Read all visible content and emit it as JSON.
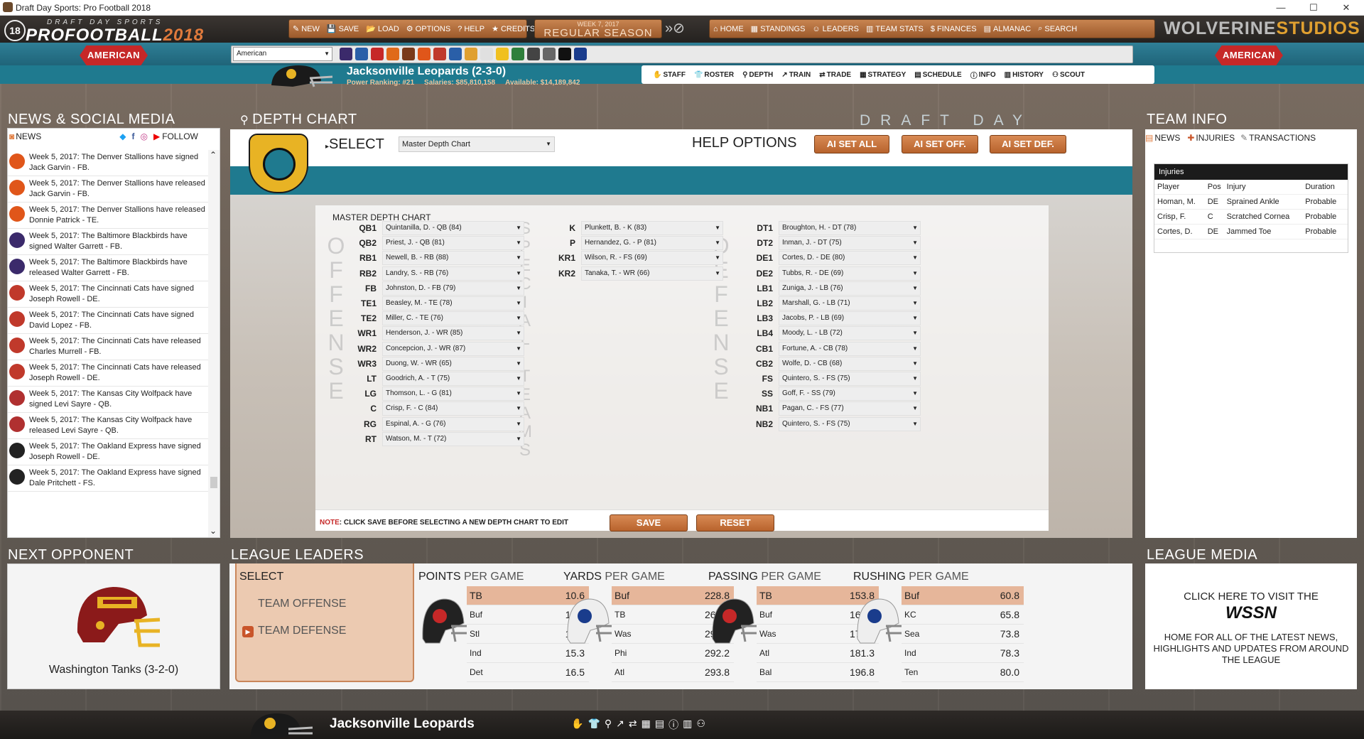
{
  "window": {
    "title": "Draft Day Sports: Pro Football 2018",
    "min": "—",
    "max": "☐",
    "close": "✕"
  },
  "logo": {
    "number": "18",
    "small": "DRAFT DAY SPORTS",
    "main": "PROFOOTBALL",
    "year": "2018"
  },
  "top_menu": [
    {
      "icon": "✎",
      "label": "NEW",
      "name": "new"
    },
    {
      "icon": "💾",
      "label": "SAVE",
      "name": "save"
    },
    {
      "icon": "📂",
      "label": "LOAD",
      "name": "load"
    },
    {
      "icon": "⚙",
      "label": "OPTIONS",
      "name": "options"
    },
    {
      "icon": "?",
      "label": "HELP",
      "name": "help"
    },
    {
      "icon": "★",
      "label": "CREDITS",
      "name": "credits"
    }
  ],
  "season": {
    "week": "WEEK 7, 2017",
    "phase": "REGULAR SEASON"
  },
  "main_nav": [
    {
      "icon": "⌂",
      "label": "HOME",
      "name": "home"
    },
    {
      "icon": "▦",
      "label": "STANDINGS",
      "name": "standings"
    },
    {
      "icon": "☺",
      "label": "LEADERS",
      "name": "leaders"
    },
    {
      "icon": "▥",
      "label": "TEAM STATS",
      "name": "team-stats"
    },
    {
      "icon": "$",
      "label": "FINANCES",
      "name": "finances"
    },
    {
      "icon": "▤",
      "label": "ALMANAC",
      "name": "almanac"
    },
    {
      "icon": "⌕",
      "label": "SEARCH",
      "name": "search"
    }
  ],
  "studios": {
    "part1": "WOLVERINE",
    "part2": "STUDIOS"
  },
  "conference": {
    "label": "AMERICAN",
    "selected": "American"
  },
  "team_logo_colors": [
    "#3b2a6b",
    "#2a5fa8",
    "#c62828",
    "#e06a1a",
    "#7a3a1a",
    "#e0561a",
    "#c0392b",
    "#2a5fa8",
    "#e0a030",
    "#e0e0e0",
    "#f0c020",
    "#2f7f3b",
    "#444",
    "#666",
    "#111",
    "#1a3c8c"
  ],
  "team": {
    "title": "Jacksonville Leopards (2-3-0)",
    "power": "Power Ranking: #21",
    "salaries": "Salaries: $85,810,158",
    "available": "Available: $14,189,842"
  },
  "team_nav": [
    {
      "icon": "✋",
      "label": "STAFF",
      "name": "staff"
    },
    {
      "icon": "👕",
      "label": "ROSTER",
      "name": "roster"
    },
    {
      "icon": "⚲",
      "label": "DEPTH",
      "name": "depth"
    },
    {
      "icon": "↗",
      "label": "TRAIN",
      "name": "train"
    },
    {
      "icon": "⇄",
      "label": "TRADE",
      "name": "trade"
    },
    {
      "icon": "▦",
      "label": "STRATEGY",
      "name": "strategy"
    },
    {
      "icon": "▤",
      "label": "SCHEDULE",
      "name": "schedule"
    },
    {
      "icon": "ⓘ",
      "label": "INFO",
      "name": "info"
    },
    {
      "icon": "▥",
      "label": "HISTORY",
      "name": "history"
    },
    {
      "icon": "⚇",
      "label": "SCOUT",
      "name": "scout"
    }
  ],
  "news": {
    "title": "NEWS & SOCIAL MEDIA",
    "tab": "NEWS",
    "follow": "FOLLOW",
    "items": [
      {
        "text": "Week 5, 2017: The Denver Stallions have signed Jack Garvin - FB.",
        "color": "#e0561a"
      },
      {
        "text": "Week 5, 2017: The Denver Stallions have released Jack Garvin - FB.",
        "color": "#e0561a"
      },
      {
        "text": "Week 5, 2017: The Denver Stallions have released Donnie Patrick - TE.",
        "color": "#e0561a"
      },
      {
        "text": "Week 5, 2017: The Baltimore Blackbirds have signed Walter Garrett - FB.",
        "color": "#3b2a6b"
      },
      {
        "text": "Week 5, 2017: The Baltimore Blackbirds have released Walter Garrett - FB.",
        "color": "#3b2a6b"
      },
      {
        "text": "Week 5, 2017: The Cincinnati Cats have signed Joseph Rowell - DE.",
        "color": "#c0392b"
      },
      {
        "text": "Week 5, 2017: The Cincinnati Cats have signed David Lopez - FB.",
        "color": "#c0392b"
      },
      {
        "text": "Week 5, 2017: The Cincinnati Cats have released Charles Murrell - FB.",
        "color": "#c0392b"
      },
      {
        "text": "Week 5, 2017: The Cincinnati Cats have released Joseph Rowell - DE.",
        "color": "#c0392b"
      },
      {
        "text": "Week 5, 2017: The Kansas City Wolfpack have signed Levi Sayre - QB.",
        "color": "#b03030"
      },
      {
        "text": "Week 5, 2017: The Kansas City Wolfpack have released Levi Sayre - QB.",
        "color": "#b03030"
      },
      {
        "text": "Week 5, 2017: The Oakland Express have signed Joseph Rowell - DE.",
        "color": "#222"
      },
      {
        "text": "Week 5, 2017: The Oakland Express have signed Dale Pritchett - FS.",
        "color": "#222"
      }
    ]
  },
  "depth": {
    "title": "DEPTH CHART",
    "banner": "DRAFT DAY SPORTS",
    "select_label": "SELECT",
    "selected_chart": "Master Depth Chart",
    "help_label": "HELP OPTIONS",
    "ai_all": "AI SET ALL",
    "ai_off": "AI SET OFF.",
    "ai_def": "AI SET DEF.",
    "master_title": "MASTER DEPTH CHART",
    "offense_letters": [
      "O",
      "F",
      "F",
      "E",
      "N",
      "S",
      "E"
    ],
    "special_letters": [
      "S",
      "P",
      "E",
      "C",
      "I",
      "A",
      "L",
      "",
      "T",
      "E",
      "A",
      "M",
      "S"
    ],
    "defense_letters": [
      "D",
      "E",
      "F",
      "E",
      "N",
      "S",
      "E"
    ],
    "offense": [
      {
        "pos": "QB1",
        "player": "Quintanilla, D. - QB (84)"
      },
      {
        "pos": "QB2",
        "player": "Priest, J. - QB (81)"
      },
      {
        "pos": "RB1",
        "player": "Newell, B. - RB (88)"
      },
      {
        "pos": "RB2",
        "player": "Landry, S. - RB (76)"
      },
      {
        "pos": "FB",
        "player": "Johnston, D. - FB (79)"
      },
      {
        "pos": "TE1",
        "player": "Beasley, M. - TE (78)"
      },
      {
        "pos": "TE2",
        "player": "Miller, C. - TE (76)"
      },
      {
        "pos": "WR1",
        "player": "Henderson, J. - WR (85)"
      },
      {
        "pos": "WR2",
        "player": "Concepcion, J. - WR (87)"
      },
      {
        "pos": "WR3",
        "player": "Duong, W. - WR (65)"
      },
      {
        "pos": "LT",
        "player": "Goodrich, A. - T (75)"
      },
      {
        "pos": "LG",
        "player": "Thomson, L. - G (81)"
      },
      {
        "pos": "C",
        "player": "Crisp, F. - C (84)"
      },
      {
        "pos": "RG",
        "player": "Espinal, A. - G (76)"
      },
      {
        "pos": "RT",
        "player": "Watson, M. - T (72)"
      }
    ],
    "special": [
      {
        "pos": "K",
        "player": "Plunkett, B. - K (83)"
      },
      {
        "pos": "P",
        "player": "Hernandez, G. - P (81)"
      },
      {
        "pos": "KR1",
        "player": "Wilson, R. - FS (69)"
      },
      {
        "pos": "KR2",
        "player": "Tanaka, T. - WR (66)"
      }
    ],
    "defense": [
      {
        "pos": "DT1",
        "player": "Broughton, H. - DT (78)"
      },
      {
        "pos": "DT2",
        "player": "Inman, J. - DT (75)"
      },
      {
        "pos": "DE1",
        "player": "Cortes, D. - DE (80)"
      },
      {
        "pos": "DE2",
        "player": "Tubbs, R. - DE (69)"
      },
      {
        "pos": "LB1",
        "player": "Zuniga, J. - LB (76)"
      },
      {
        "pos": "LB2",
        "player": "Marshall, G. - LB (71)"
      },
      {
        "pos": "LB3",
        "player": "Jacobs, P. - LB (69)"
      },
      {
        "pos": "LB4",
        "player": "Moody, L. - LB (72)"
      },
      {
        "pos": "CB1",
        "player": "Fortune, A. - CB (78)"
      },
      {
        "pos": "CB2",
        "player": "Wolfe, D. - CB (68)"
      },
      {
        "pos": "FS",
        "player": "Quintero, S. - FS (75)"
      },
      {
        "pos": "SS",
        "player": "Goff, F. - SS (79)"
      },
      {
        "pos": "NB1",
        "player": "Pagan, C. - FS (77)"
      },
      {
        "pos": "NB2",
        "player": "Quintero, S. - FS (75)"
      }
    ],
    "note_label": "NOTE",
    "note_text": ": CLICK SAVE BEFORE SELECTING A NEW DEPTH CHART TO EDIT",
    "save": "SAVE",
    "reset": "RESET"
  },
  "team_info": {
    "title": "TEAM INFO",
    "tabs": [
      "NEWS",
      "INJURIES",
      "TRANSACTIONS"
    ],
    "injuries_title": "Injuries",
    "columns": [
      "Player",
      "Pos",
      "Injury",
      "Duration"
    ],
    "rows": [
      [
        "Homan, M.",
        "DE",
        "Sprained Ankle",
        "Probable"
      ],
      [
        "Crisp, F.",
        "C",
        "Scratched Cornea",
        "Probable"
      ],
      [
        "Cortes, D.",
        "DE",
        "Jammed Toe",
        "Probable"
      ]
    ]
  },
  "next_opponent": {
    "title": "NEXT OPPONENT",
    "name": "Washington Tanks (3-2-0)"
  },
  "league_leaders": {
    "title": "LEAGUE LEADERS",
    "select": "SELECT",
    "team_offense": "TEAM OFFENSE",
    "team_defense": "TEAM DEFENSE",
    "categories": [
      {
        "bold": "POINTS",
        "rest": " PER GAME",
        "helmet": "pirate",
        "rows": [
          [
            "TB",
            "10.6"
          ],
          [
            "Buf",
            "10.6"
          ],
          [
            "Stl",
            "12.0"
          ],
          [
            "Ind",
            "15.3"
          ],
          [
            "Det",
            "16.5"
          ]
        ]
      },
      {
        "bold": "YARDS",
        "rest": " PER GAME",
        "helmet": "bull",
        "rows": [
          [
            "Buf",
            "228.8"
          ],
          [
            "TB",
            "262.0"
          ],
          [
            "Was",
            "290.4"
          ],
          [
            "Phi",
            "292.2"
          ],
          [
            "Atl",
            "293.8"
          ]
        ]
      },
      {
        "bold": "PASSING",
        "rest": " PER GAME",
        "helmet": "pirate",
        "rows": [
          [
            "TB",
            "153.8"
          ],
          [
            "Buf",
            "168.0"
          ],
          [
            "Was",
            "177.2"
          ],
          [
            "Atl",
            "181.3"
          ],
          [
            "Bal",
            "196.8"
          ]
        ]
      },
      {
        "bold": "RUSHING",
        "rest": " PER GAME",
        "helmet": "bull",
        "rows": [
          [
            "Buf",
            "60.8"
          ],
          [
            "KC",
            "65.8"
          ],
          [
            "Sea",
            "73.8"
          ],
          [
            "Ind",
            "78.3"
          ],
          [
            "Ten",
            "80.0"
          ]
        ]
      }
    ]
  },
  "league_media": {
    "title": "LEAGUE MEDIA",
    "line1": "CLICK HERE TO VISIT THE",
    "brand": "WSSN",
    "line2": "HOME FOR ALL OF THE LATEST NEWS, HIGHLIGHTS AND UPDATES FROM AROUND THE LEAGUE"
  },
  "bottom_bar": {
    "team": "Jacksonville Leopards",
    "icons": [
      "✋",
      "👕",
      "⚲",
      "↗",
      "⇄",
      "▦",
      "▤",
      "ⓘ",
      "▥",
      "⚇"
    ]
  }
}
